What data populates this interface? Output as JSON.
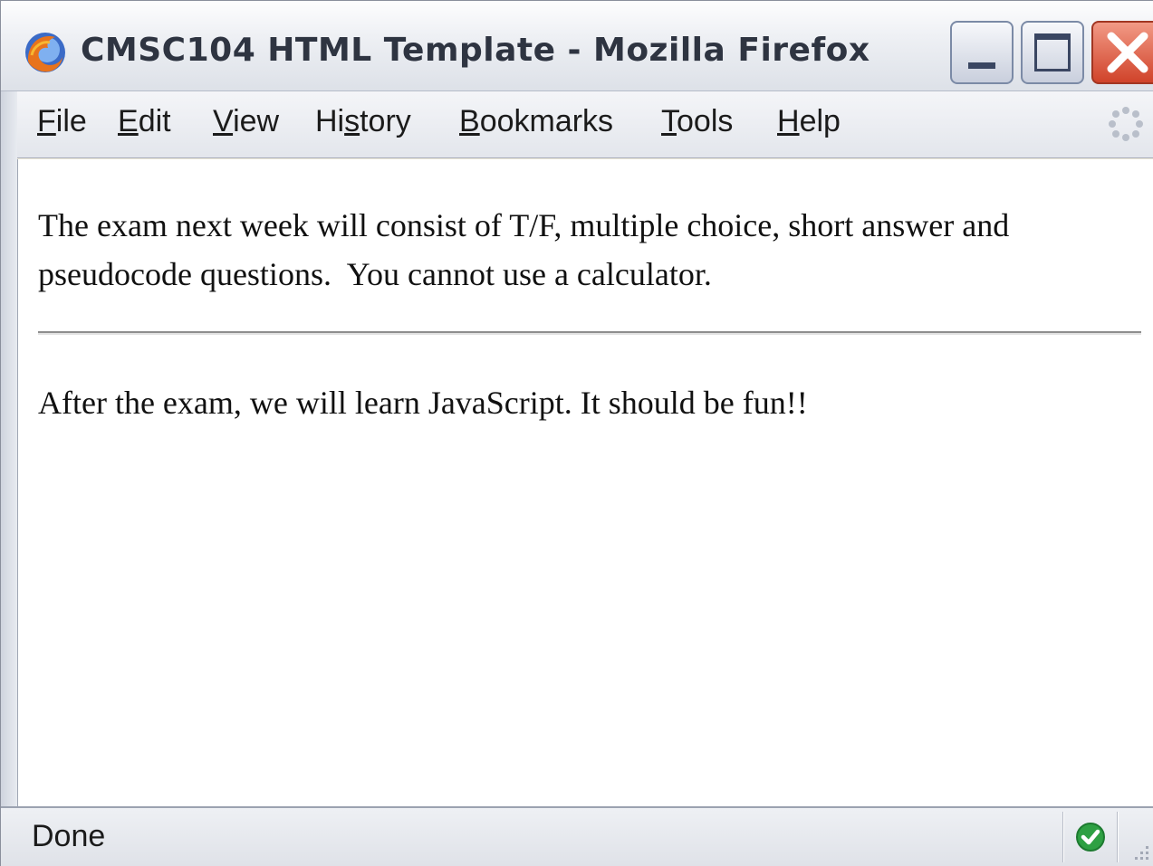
{
  "window": {
    "title": "CMSC104 HTML Template - Mozilla Firefox",
    "icon": "firefox-icon",
    "controls": [
      "minimize-icon",
      "maximize-icon",
      "close-icon"
    ]
  },
  "menubar": {
    "items": [
      {
        "label": "File",
        "mnemonic": "F"
      },
      {
        "label": "Edit",
        "mnemonic": "E"
      },
      {
        "label": "View",
        "mnemonic": "V"
      },
      {
        "label": "History",
        "mnemonic": "s"
      },
      {
        "label": "Bookmarks",
        "mnemonic": "B"
      },
      {
        "label": "Tools",
        "mnemonic": "T"
      },
      {
        "label": "Help",
        "mnemonic": "H"
      }
    ],
    "throbber": "throbber-icon"
  },
  "content": {
    "paragraph1_line1": "The exam next week will consist of T/F, multiple choice, short answer and",
    "paragraph1_line2": "pseudocode questions.  You cannot use a calculator.",
    "paragraph2": "After the exam, we will learn JavaScript. It should be fun!!"
  },
  "statusbar": {
    "text": "Done",
    "security_icon": "check-icon"
  },
  "colors": {
    "close_button": "#d0432a",
    "status_ok": "#2ea043"
  }
}
